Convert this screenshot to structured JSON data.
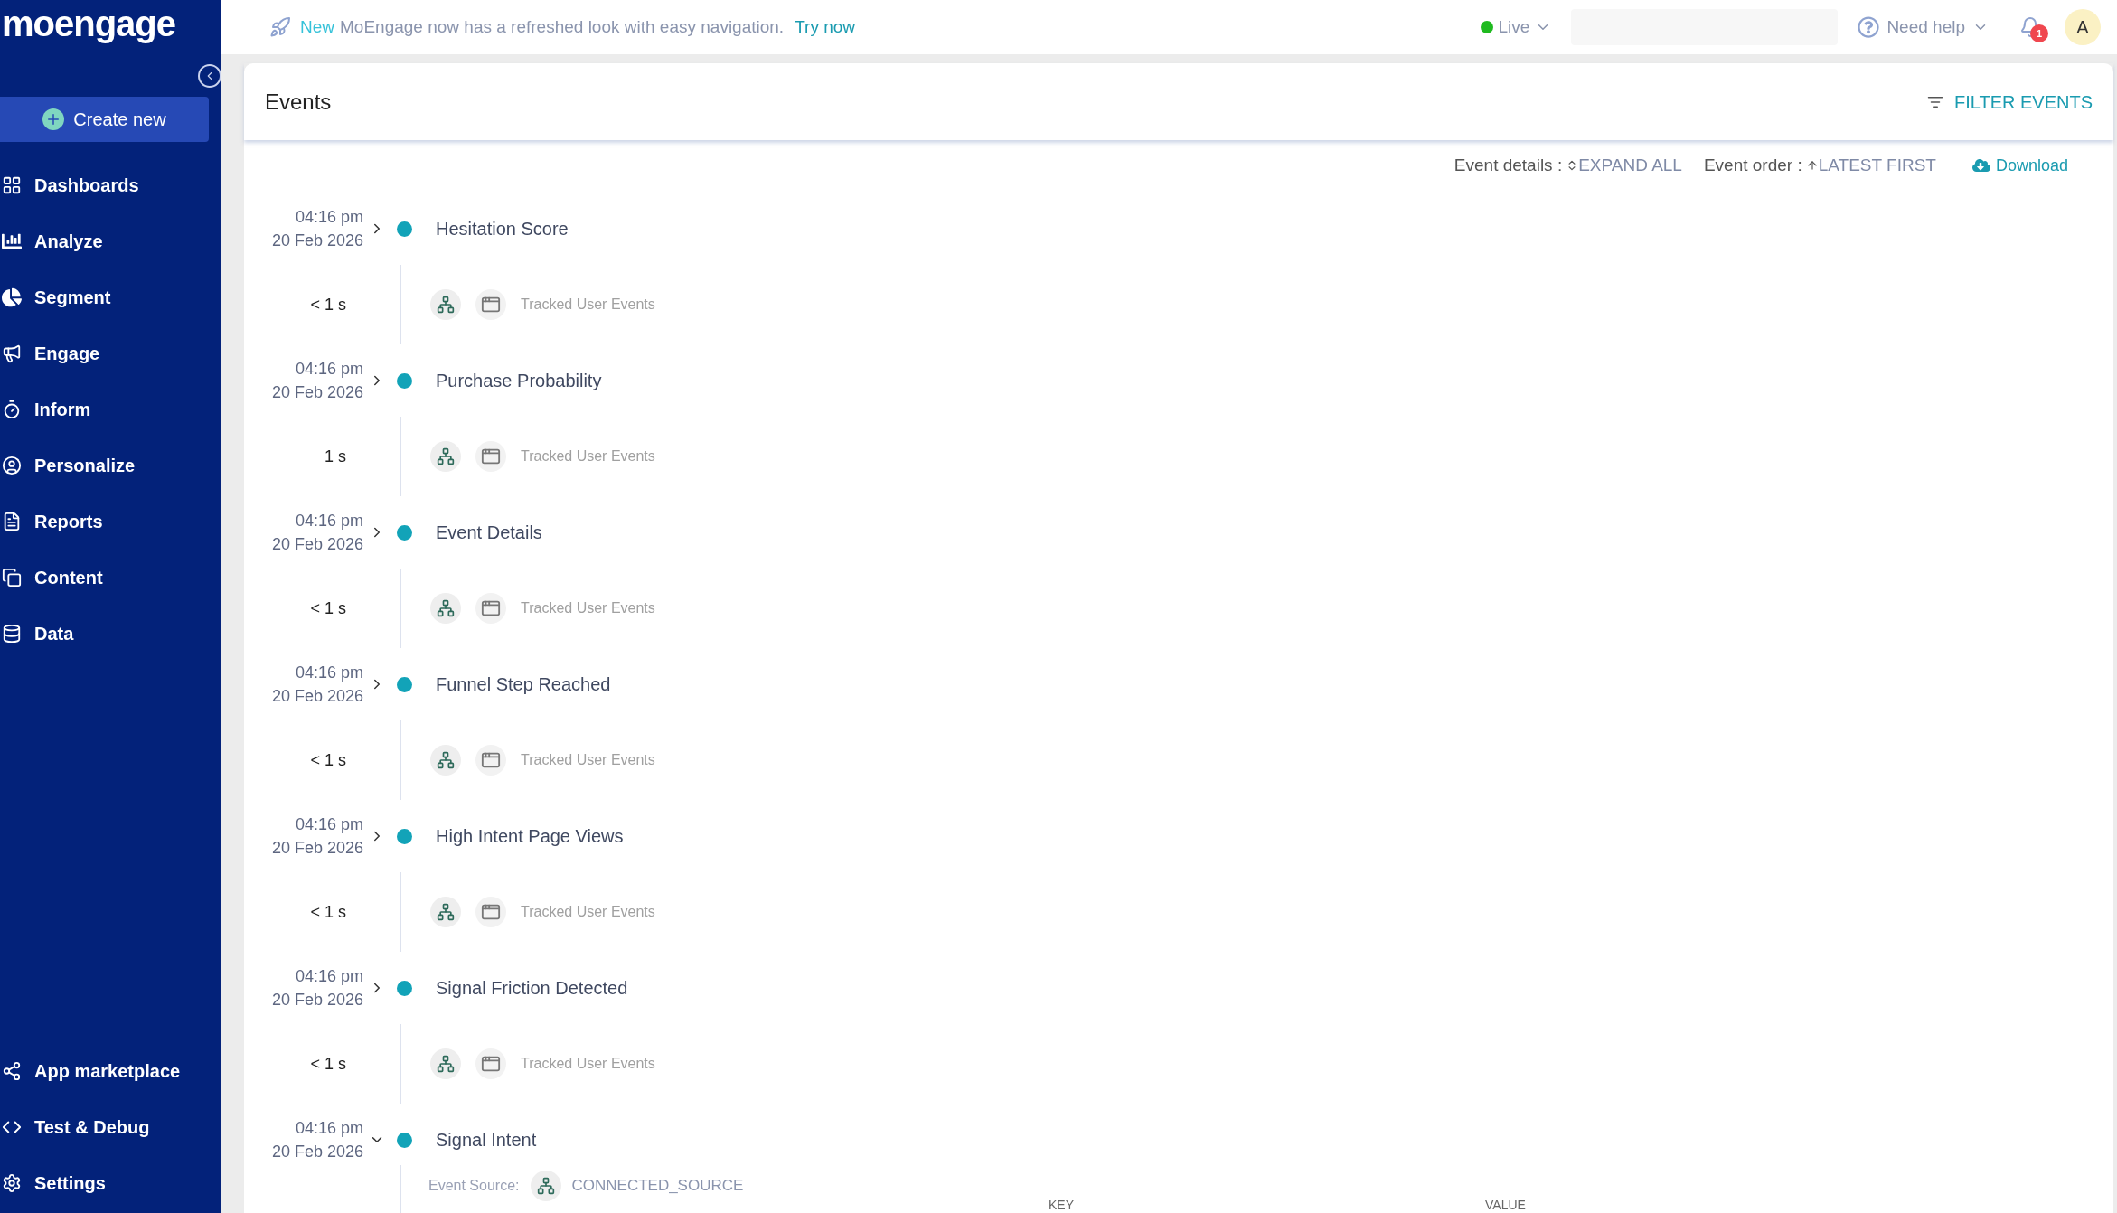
{
  "sidebar": {
    "logo": "moengage",
    "create_button": "Create new",
    "items": [
      {
        "label": "Dashboards"
      },
      {
        "label": "Analyze"
      },
      {
        "label": "Segment"
      },
      {
        "label": "Engage"
      },
      {
        "label": "Inform"
      },
      {
        "label": "Personalize"
      },
      {
        "label": "Reports"
      },
      {
        "label": "Content"
      },
      {
        "label": "Data"
      }
    ],
    "bottom_items": [
      {
        "label": "App marketplace"
      },
      {
        "label": "Test & Debug"
      },
      {
        "label": "Settings"
      }
    ]
  },
  "top_bar": {
    "announcement": {
      "badge": "New",
      "text": "MoEngage now has a refreshed look with easy navigation.",
      "link": "Try now"
    },
    "environment": "Live",
    "help": "Need help",
    "notifications": "1",
    "avatar": "A"
  },
  "card": {
    "title": "Events",
    "filter_button": "FILTER EVENTS",
    "toolbar": {
      "details_label": "Event details :",
      "details_action": "EXPAND ALL",
      "order_label": "Event order :",
      "order_action": "LATEST FIRST",
      "download": "Download"
    },
    "events": [
      {
        "time": "04:16 pm",
        "date": "20 Feb 2026",
        "name": "Hesitation Score",
        "expanded": false,
        "duration": "< 1 s",
        "source": "Tracked User Events"
      },
      {
        "time": "04:16 pm",
        "date": "20 Feb 2026",
        "name": "Purchase Probability",
        "expanded": false,
        "duration": "1 s",
        "source": "Tracked User Events"
      },
      {
        "time": "04:16 pm",
        "date": "20 Feb 2026",
        "name": "Event Details",
        "expanded": false,
        "duration": "< 1 s",
        "source": "Tracked User Events"
      },
      {
        "time": "04:16 pm",
        "date": "20 Feb 2026",
        "name": "Funnel Step Reached",
        "expanded": false,
        "duration": "< 1 s",
        "source": "Tracked User Events"
      },
      {
        "time": "04:16 pm",
        "date": "20 Feb 2026",
        "name": "High Intent Page Views",
        "expanded": false,
        "duration": "< 1 s",
        "source": "Tracked User Events"
      },
      {
        "time": "04:16 pm",
        "date": "20 Feb 2026",
        "name": "Signal Friction Detected",
        "expanded": false,
        "duration": "< 1 s",
        "source": "Tracked User Events"
      },
      {
        "time": "04:16 pm",
        "date": "20 Feb 2026",
        "name": "Signal Intent",
        "expanded": true,
        "details": {
          "source_label": "Event Source:",
          "source_value": "CONNECTED_SOURCE",
          "columns": [
            "KEY",
            "VALUE"
          ]
        }
      }
    ]
  }
}
